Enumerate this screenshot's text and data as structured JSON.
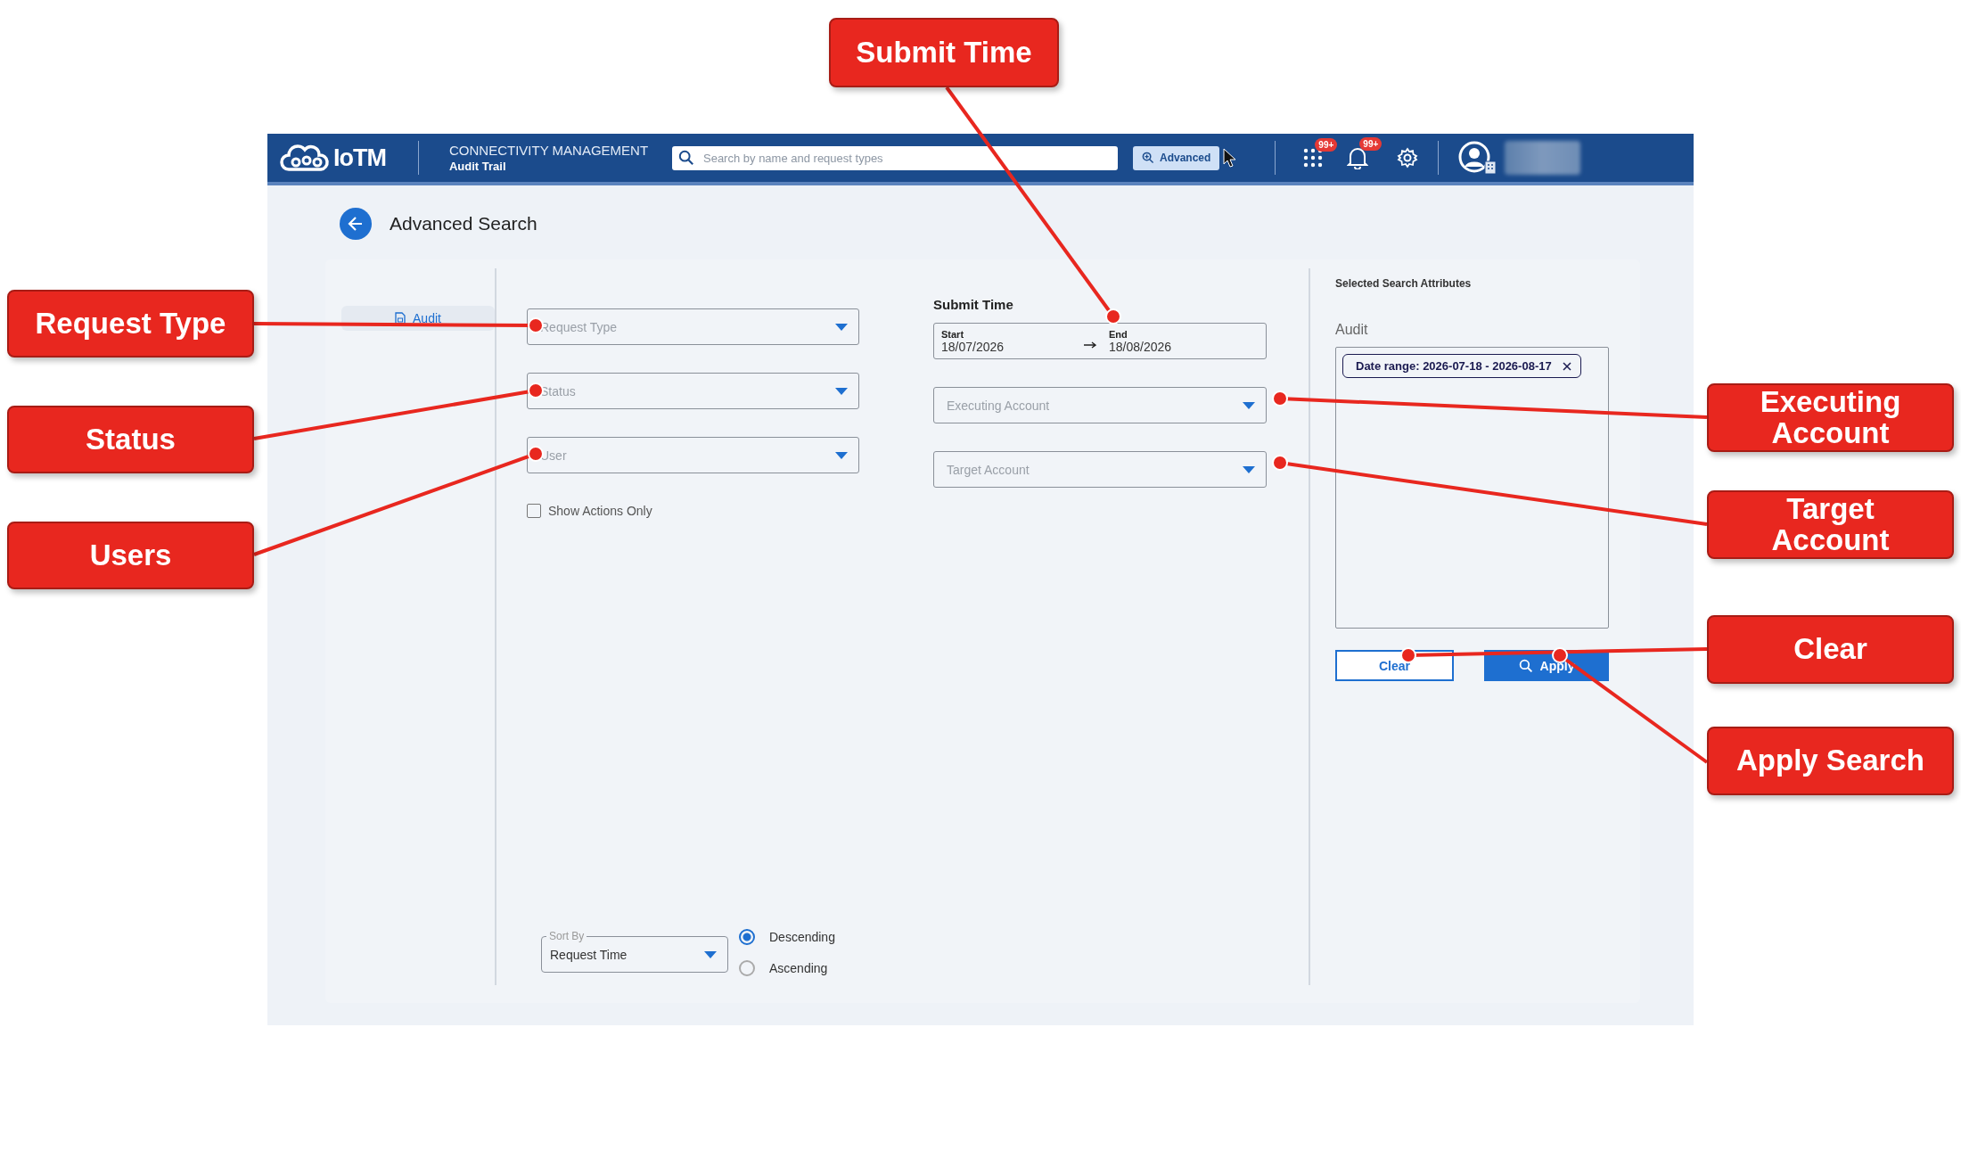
{
  "header": {
    "logo": "IoTM",
    "app_title": "CONNECTIVITY MANAGEMENT",
    "page_subtitle": "Audit Trail",
    "search": {
      "placeholder": "Search by name and request types"
    },
    "advanced_button": "Advanced",
    "apps_badge": "99+",
    "notifications_badge": "99+"
  },
  "page_title": "Advanced Search",
  "nav": [
    {
      "label": "Audit",
      "selected": true
    }
  ],
  "filters": [
    {
      "placeholder": "Request Type"
    },
    {
      "placeholder": "Status"
    },
    {
      "placeholder": "User"
    }
  ],
  "show_actions_only": {
    "label": "Show Actions Only",
    "checked": false
  },
  "submit_time": {
    "label": "Submit Time",
    "start_label": "Start",
    "start": "18/07/2026",
    "end_label": "End",
    "end": "18/08/2026"
  },
  "account_filters": [
    {
      "placeholder": "Executing Account"
    },
    {
      "placeholder": "Target Account"
    }
  ],
  "sort": {
    "label": "Sort By",
    "value": "Request Time",
    "orders": [
      {
        "label": "Descending",
        "selected": true
      },
      {
        "label": "Ascending",
        "selected": false
      }
    ]
  },
  "selected_attributes": {
    "title": "Selected Search Attributes",
    "group": "Audit",
    "chips": [
      "Date range: 2026-07-18 - 2026-08-17"
    ]
  },
  "buttons": {
    "clear": "Clear",
    "apply": "Apply"
  },
  "callouts": [
    {
      "label": "Submit Time"
    },
    {
      "label": "Request Type"
    },
    {
      "label": "Status"
    },
    {
      "label": "Users"
    },
    {
      "label": "Executing Account"
    },
    {
      "label": "Target Account"
    },
    {
      "label": "Clear"
    },
    {
      "label": "Apply Search"
    }
  ]
}
